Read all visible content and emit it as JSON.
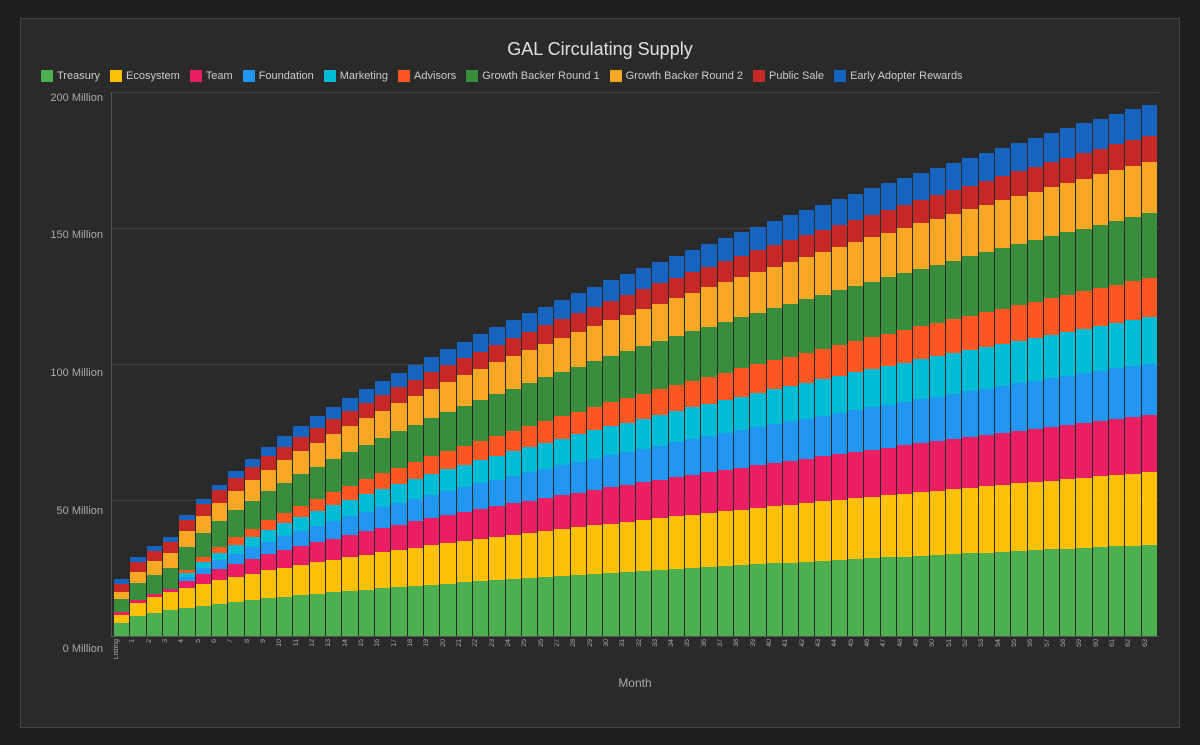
{
  "chart": {
    "title": "GAL Circulating Supply",
    "axis_x_label": "Month",
    "y_labels": [
      "200 Million",
      "150 Million",
      "100 Million",
      "50 Million",
      "0 Million"
    ],
    "legend": [
      {
        "name": "Treasury",
        "color": "#4caf50"
      },
      {
        "name": "Ecosystem",
        "color": "#ffc107"
      },
      {
        "name": "Team",
        "color": "#e91e63"
      },
      {
        "name": "Foundation",
        "color": "#2196f3"
      },
      {
        "name": "Marketing",
        "color": "#00bcd4"
      },
      {
        "name": "Advisors",
        "color": "#ff5722"
      },
      {
        "name": "Growth Backer Round 1",
        "color": "#388e3c"
      },
      {
        "name": "Growth Backer Round 2",
        "color": "#f9a825"
      },
      {
        "name": "Public Sale",
        "color": "#c62828"
      },
      {
        "name": "Early Adopter Rewards",
        "color": "#1565c0"
      }
    ],
    "x_labels": [
      "Listing",
      "1",
      "2",
      "3",
      "4",
      "5",
      "6",
      "7",
      "8",
      "9",
      "10",
      "11",
      "12",
      "13",
      "14",
      "15",
      "16",
      "17",
      "18",
      "19",
      "20",
      "21",
      "22",
      "23",
      "24",
      "25",
      "26",
      "27",
      "28",
      "29",
      "30",
      "31",
      "32",
      "33",
      "34",
      "35",
      "36",
      "37",
      "38",
      "39",
      "40",
      "41",
      "42",
      "43",
      "44",
      "45",
      "46",
      "47",
      "48",
      "49",
      "50",
      "51",
      "52",
      "53",
      "54",
      "55",
      "56",
      "57",
      "58",
      "59",
      "60",
      "61",
      "62",
      "63"
    ],
    "max_value": 210
  }
}
